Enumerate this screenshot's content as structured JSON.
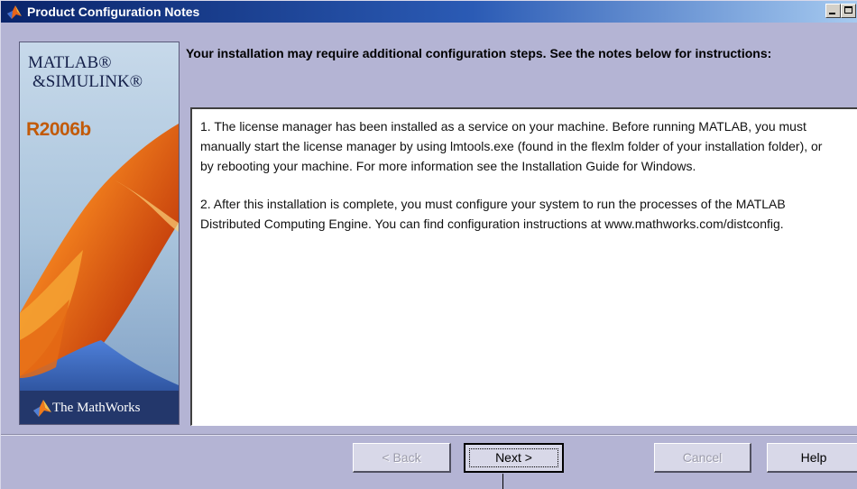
{
  "window": {
    "title": "Product Configuration Notes",
    "title_icon": "matlab-membrane-icon",
    "controls": [
      "minimize",
      "maximize"
    ]
  },
  "banner": {
    "product_line1": "MATLAB®",
    "product_line2": "&SIMULINK®",
    "release": "R2006b",
    "company": "The MathWorks",
    "colors": {
      "release": "#c25a08",
      "footer": "#23376b"
    }
  },
  "heading": "Your installation may require additional configuration steps.  See the notes below for instructions:",
  "notes": [
    "1. The license manager has been installed as a service on your machine.  Before running MATLAB, you must manually start the license manager by using lmtools.exe (found in the flexlm folder of your installation folder), or by rebooting your machine.  For more information see the Installation Guide for Windows.",
    "2. After this installation is complete, you must configure your system to run the processes of the MATLAB Distributed Computing Engine.  You can find configuration instructions at www.mathworks.com/distconfig."
  ],
  "buttons": {
    "back": "< Back",
    "next": "Next >",
    "cancel": "Cancel",
    "help": "Help"
  },
  "colors": {
    "window_bg": "#b4b4d4",
    "titlebar_start": "#0a246a",
    "titlebar_end": "#a6caf0"
  }
}
